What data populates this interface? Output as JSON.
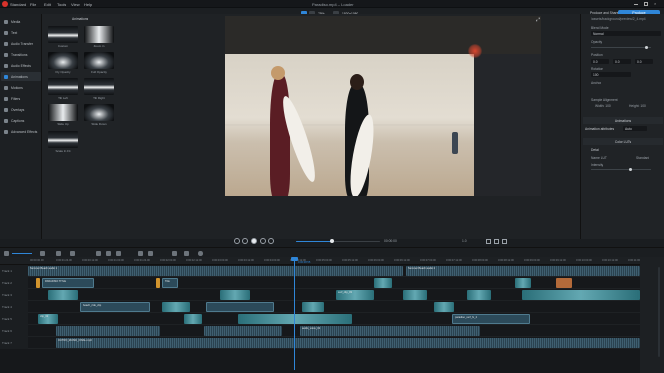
{
  "menu": {
    "app": "Standard",
    "items": [
      "File",
      "Edit",
      "Tools",
      "View",
      "Help"
    ]
  },
  "window": {
    "title": "Paradiso.mp4 – Loader"
  },
  "topbar": {
    "zoom": "75%",
    "resolution": "1920x1080",
    "publish_label": "Produce and Share",
    "produce_label": "Produce"
  },
  "leftnav": {
    "items": [
      "Media",
      "Text",
      "Audio Transfer",
      "Transitions",
      "Audio Effects",
      "Animations",
      "Motions",
      "Filters",
      "Overlays",
      "Captions",
      "Advanced Effects"
    ]
  },
  "effects": {
    "header": "Animations",
    "tiles": [
      {
        "label": "Custom"
      },
      {
        "label": "Zoom in"
      },
      {
        "label": "Fly Opacity"
      },
      {
        "label": "Full Opacity"
      },
      {
        "label": "Tilt Left"
      },
      {
        "label": "Tilt Right"
      },
      {
        "label": "Slide Up"
      },
      {
        "label": "Slide Down"
      },
      {
        "label": "Scale In Fit"
      }
    ]
  },
  "rightpanel": {
    "path": "/assets/background/preview/2_4.mp4",
    "blend_label": "Blend Mode",
    "blend_value": "Normal",
    "opacity_label": "Opacity",
    "position_label": "Position",
    "pos_x": "0.0",
    "pos_y": "0.0",
    "position_z": "0.0",
    "rotation_label": "Rotation",
    "rotation_value": "100",
    "anchor_label": "Anchor",
    "sample_label": "Sample Alignment",
    "width_label": "Width: 100",
    "height_label": "Height: 100",
    "animations_label": "Animations",
    "anim_attr_label": "Animation attributes",
    "anim_attr_value": "Auto",
    "lut_header": "Color LUTs",
    "lut_detail": "Detail",
    "lut_name_label": "Name LUT",
    "lut_name_value": "Standard",
    "lut_intensity": "Intensity"
  },
  "playback": {
    "time": "00:00:00",
    "duration": "1.0"
  },
  "timeline": {
    "ticks": [
      "00:00:00.00",
      "0:00:01:24.00",
      "0:00:00:12.00",
      "0:00:01:00.00",
      "0:00:01:24.00",
      "0:00:02:00.00",
      "0:00:02:12.00",
      "0:00:03:00.00",
      "0:00:03:12.00",
      "0:00:04:00.00",
      "0:00:04:12.00",
      "0:00:05:00.00",
      "0:00:05:12.00",
      "0:00:06:00.00",
      "0:00:06:12.00",
      "0:00:07:00.00",
      "0:00:07:12.00",
      "0:00:08:00.00",
      "0:00:08:12.00",
      "0:00:09:00.00",
      "0:00:09:12.00",
      "0:00:10:00.00",
      "0:00:10:12.00",
      "0:00:11:00.00"
    ],
    "playhead_time": "0:00:08:55",
    "tracks": [
      {
        "label": "Track 1",
        "clips": [
          {
            "label": "Summer Beach audio 1"
          },
          {
            "label": "Summer Beach audio 2"
          }
        ]
      },
      {
        "label": "Track 2",
        "clips": [
          {
            "label": "PARADISO TITLE"
          },
          {
            "label": "Title"
          },
          {
            "label": ""
          }
        ]
      },
      {
        "label": "Track 3",
        "clips": [
          {
            "label": ""
          },
          {
            "label": "surf_clip_03"
          }
        ]
      },
      {
        "label": "Track 4",
        "clips": [
          {
            "label": "beach_ride_clip"
          },
          {
            "label": ""
          }
        ]
      },
      {
        "label": "Track 5",
        "clips": [
          {
            "label": "clip_02"
          },
          {
            "label": "paradiso_surf_fx_2"
          }
        ]
      },
      {
        "label": "Track 6",
        "clips": [
          {
            "label": ""
          },
          {
            "label": "audio_voice_02"
          }
        ]
      },
      {
        "label": "Track 7",
        "clips": [
          {
            "label": "OUTRO_MUSIC_FINAL.mp3"
          }
        ]
      }
    ]
  },
  "colors": {
    "accent": "#2f86d8",
    "record": "#d8462e",
    "bg": "#1a1d20"
  }
}
